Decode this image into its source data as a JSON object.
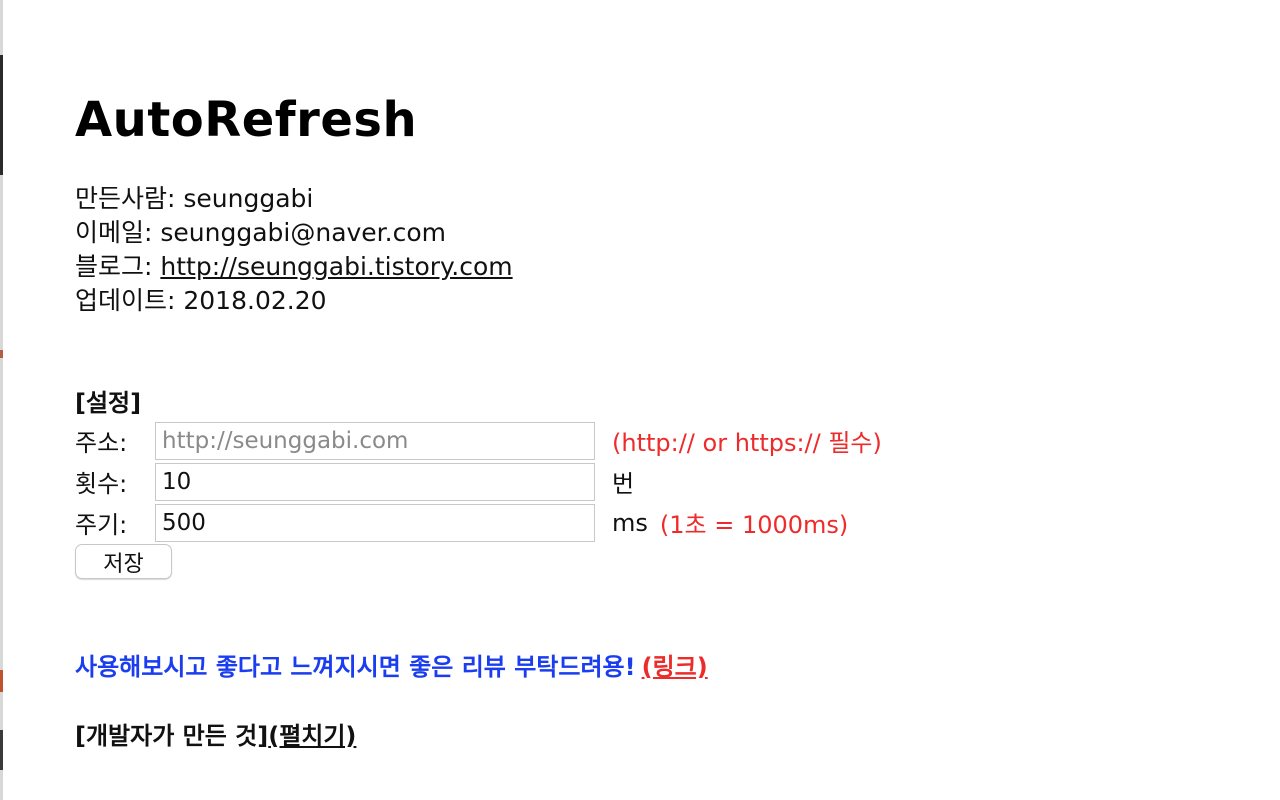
{
  "title": "AutoRefresh",
  "info": {
    "author_label": "만든사람: ",
    "author": "seunggabi",
    "email_label": "이메일: ",
    "email": "seunggabi@naver.com",
    "blog_label": "블로그: ",
    "blog_link": "http://seunggabi.tistory.com",
    "update_label": "업데이트: ",
    "update_date": "2018.02.20"
  },
  "settings": {
    "title": "[설정]",
    "address_label": "주소:",
    "address_placeholder": "http://seunggabi.com",
    "address_value": "",
    "address_note": "(http:// or https:// 필수)",
    "count_label": "횟수:",
    "count_value": "10",
    "count_unit": "번",
    "period_label": "주기:",
    "period_value": "500",
    "period_unit": "ms",
    "period_note": "(1초 = 1000ms)",
    "save_label": "저장"
  },
  "review": {
    "text": "사용해보시고 좋다고 느껴지시면 좋은 리뷰 부탁드려용!",
    "link": "(링크)"
  },
  "developer": {
    "text": "[개발자가 만든 것]",
    "toggle": "(펼치기)"
  },
  "colors": {
    "accent_red": "#ee2b2b",
    "accent_blue": "#1a3df0"
  }
}
